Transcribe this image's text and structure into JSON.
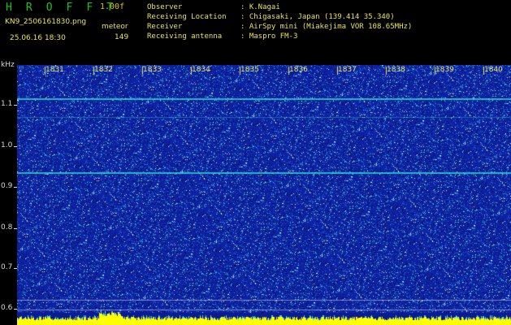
{
  "header": {
    "app_title": "H R O F F T",
    "version": "1.00f",
    "filename": "KN9_2506161830.png",
    "meteor_label": "meteor",
    "datetime": "25.06.16 18:30",
    "meteor_count": "149"
  },
  "info": [
    {
      "key": "Observer",
      "value": ": K.Nagai"
    },
    {
      "key": "Receiving Location",
      "value": ": Chigasaki, Japan (139.414 35.340)"
    },
    {
      "key": "Receiver",
      "value": ": AirSpy mini (Miakejima VOR 108.65MHz)"
    },
    {
      "key": "Receiving antenna",
      "value": ": Maspro FM-3"
    }
  ],
  "axis": {
    "y_unit": "kHz",
    "y_ticks": [
      "1.1",
      "1.0",
      "0.9",
      "0.8",
      "0.7",
      "0.6"
    ],
    "x_ticks": [
      "1831",
      "1832",
      "1833",
      "1834",
      "1835",
      "1836",
      "1837",
      "1838",
      "1839",
      "1840"
    ]
  },
  "colors": {
    "background": "#000000",
    "spectrogram_base": "#1428a0",
    "header_text": "#e8e35a",
    "title_text": "#19c21d",
    "signal": "#34e3d2",
    "noise_floor": "#ffff00"
  }
}
